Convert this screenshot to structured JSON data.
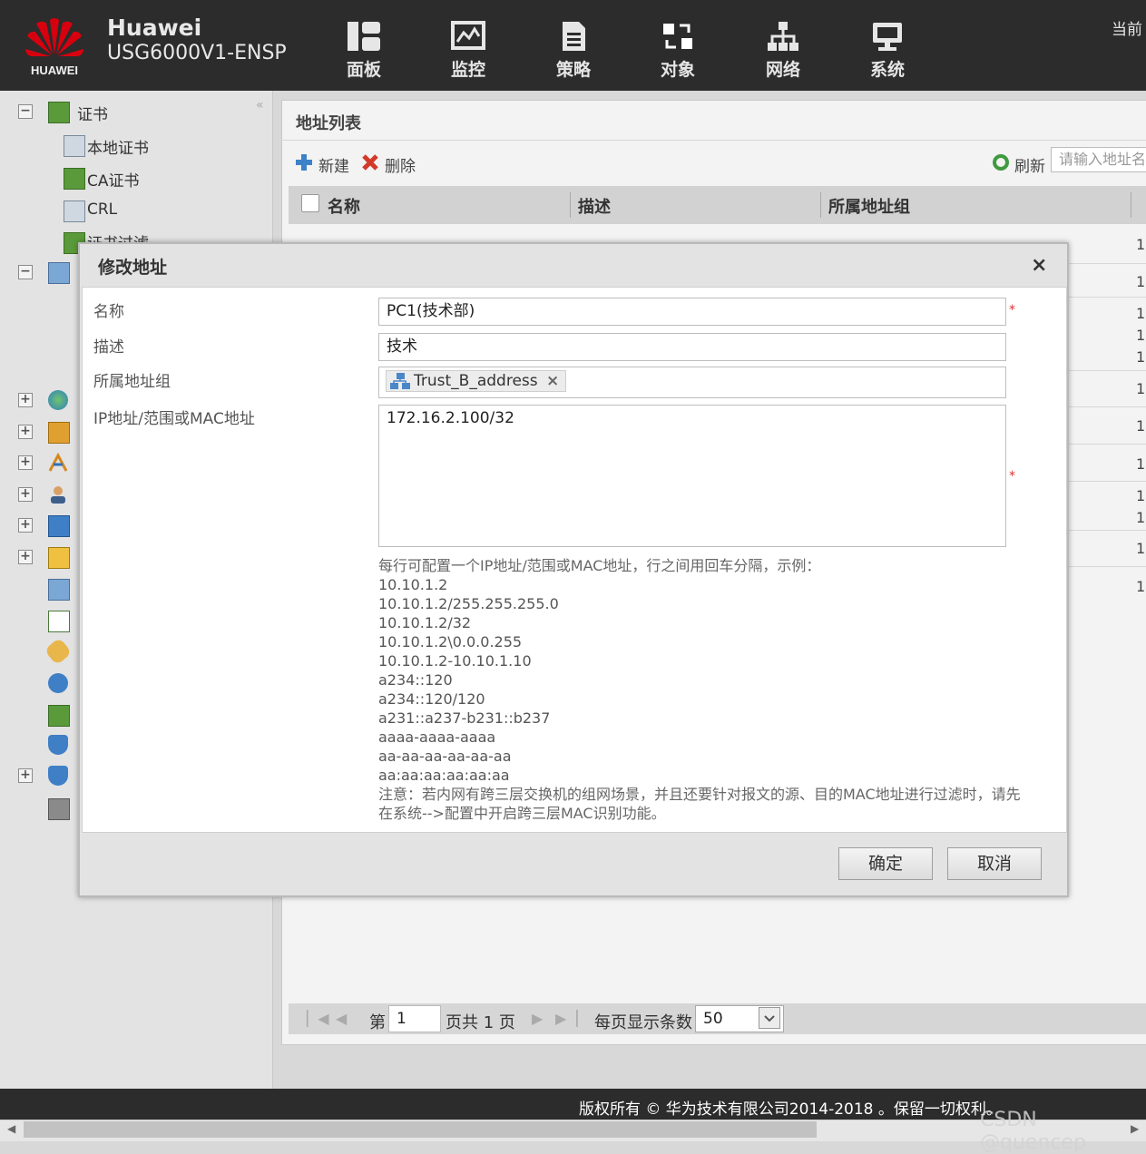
{
  "header": {
    "logo_text": "HUAWEI",
    "brand": "Huawei",
    "model": "USG6000V1-ENSP",
    "nav": [
      {
        "label": "面板",
        "icon": "dashboard-icon"
      },
      {
        "label": "监控",
        "icon": "monitor-icon"
      },
      {
        "label": "策略",
        "icon": "policy-icon"
      },
      {
        "label": "对象",
        "icon": "object-icon"
      },
      {
        "label": "网络",
        "icon": "network-icon"
      },
      {
        "label": "系统",
        "icon": "system-icon"
      }
    ],
    "current_label": "当前"
  },
  "sidebar": {
    "collapse_glyph": "«",
    "items": [
      {
        "label": "证书"
      },
      {
        "label": "本地证书"
      },
      {
        "label": "CA证书"
      },
      {
        "label": "CRL"
      },
      {
        "label": "证书过滤"
      }
    ]
  },
  "main": {
    "title": "地址列表",
    "toolbar": {
      "new_label": "新建",
      "delete_label": "删除",
      "refresh_label": "刷新",
      "search_placeholder": "请输入地址名"
    },
    "columns": [
      "名称",
      "描述",
      "所属地址组"
    ],
    "row_counts": [
      "1",
      "1",
      "1",
      "1",
      "1",
      "1",
      "1",
      "1",
      "1",
      "1",
      "1",
      "1",
      "1"
    ],
    "pager": {
      "prefix": "第",
      "page": "1",
      "mid": "页共 1 页",
      "per_page_label": "每页显示条数",
      "per_page": "50"
    }
  },
  "dialog": {
    "title": "修改地址",
    "close": "×",
    "fields": {
      "name_label": "名称",
      "name_value": "PC1(技术部)",
      "desc_label": "描述",
      "desc_value": "技术",
      "group_label": "所属地址组",
      "group_tag": "Trust_B_address",
      "ip_label": "IP地址/范围或MAC地址",
      "ip_value": "172.16.2.100/32",
      "required_mark": "*"
    },
    "hint": "每行可配置一个IP地址/范围或MAC地址，行之间用回车分隔，示例：",
    "examples": [
      "10.10.1.2",
      "10.10.1.2/255.255.255.0",
      "10.10.1.2/32",
      "10.10.1.2\\0.0.0.255",
      "10.10.1.2-10.10.1.10",
      "a234::120",
      "a234::120/120",
      "a231::a237-b231::b237",
      "aaaa-aaaa-aaaa",
      "aa-aa-aa-aa-aa-aa",
      "aa:aa:aa:aa:aa:aa"
    ],
    "note": "注意：若内网有跨三层交换机的组网场景，并且还要针对报文的源、目的MAC地址进行过滤时，请先在系统-->配置中开启跨三层MAC识别功能。",
    "ok_label": "确定",
    "cancel_label": "取消"
  },
  "footer": {
    "copyright": "版权所有 © 华为技术有限公司2014-2018 。保留一切权利。",
    "watermark": "CSDN @quencep"
  },
  "colors": {
    "header_bg": "#2c2c2c",
    "required": "#e03030",
    "huawei_red": "#d7000f"
  }
}
